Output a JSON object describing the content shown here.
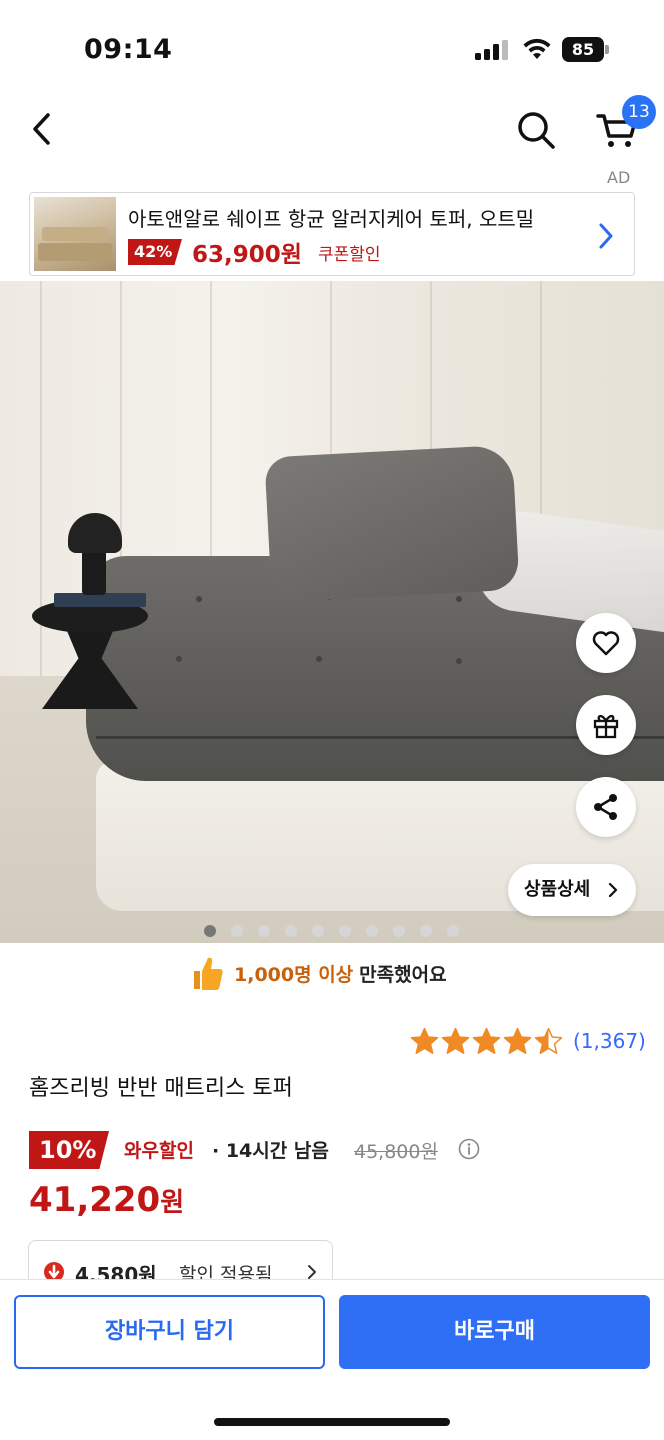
{
  "status_bar": {
    "time": "09:14",
    "battery": "85"
  },
  "nav": {
    "cart_count": "13",
    "ad_label": "AD"
  },
  "ad_banner": {
    "title": "아토앤알로 쉐이프 항균 알러지케어 토퍼, 오트밀",
    "discount": "42%",
    "price": "63,900원",
    "coupon": "쿠폰할인"
  },
  "image": {
    "detail_button": "상품상세",
    "dot_count": 10,
    "active_dot": 0
  },
  "satisfaction": {
    "strong": "1,000명 이상",
    "rest": "만족했어요"
  },
  "rating": {
    "stars": 4.5,
    "review_count": "(1,367)"
  },
  "product": {
    "title": "홈즈리빙 반반 매트리스 토퍼",
    "discount": "10%",
    "wow_label": "와우할인",
    "time_left": "· 14시간 남음",
    "original_price": "45,800원",
    "final_price": "41,220",
    "final_unit": "원"
  },
  "coupon": {
    "amount": "4,580원",
    "text": "할인 적용됨"
  },
  "bottom_bar": {
    "cart_button": "장바구니 담기",
    "buy_button": "바로구매"
  },
  "colors": {
    "accent_blue": "#2f6ff5",
    "sale_red": "#c01616",
    "satisfaction_orange": "#c9600a",
    "star": "#f08a24"
  }
}
